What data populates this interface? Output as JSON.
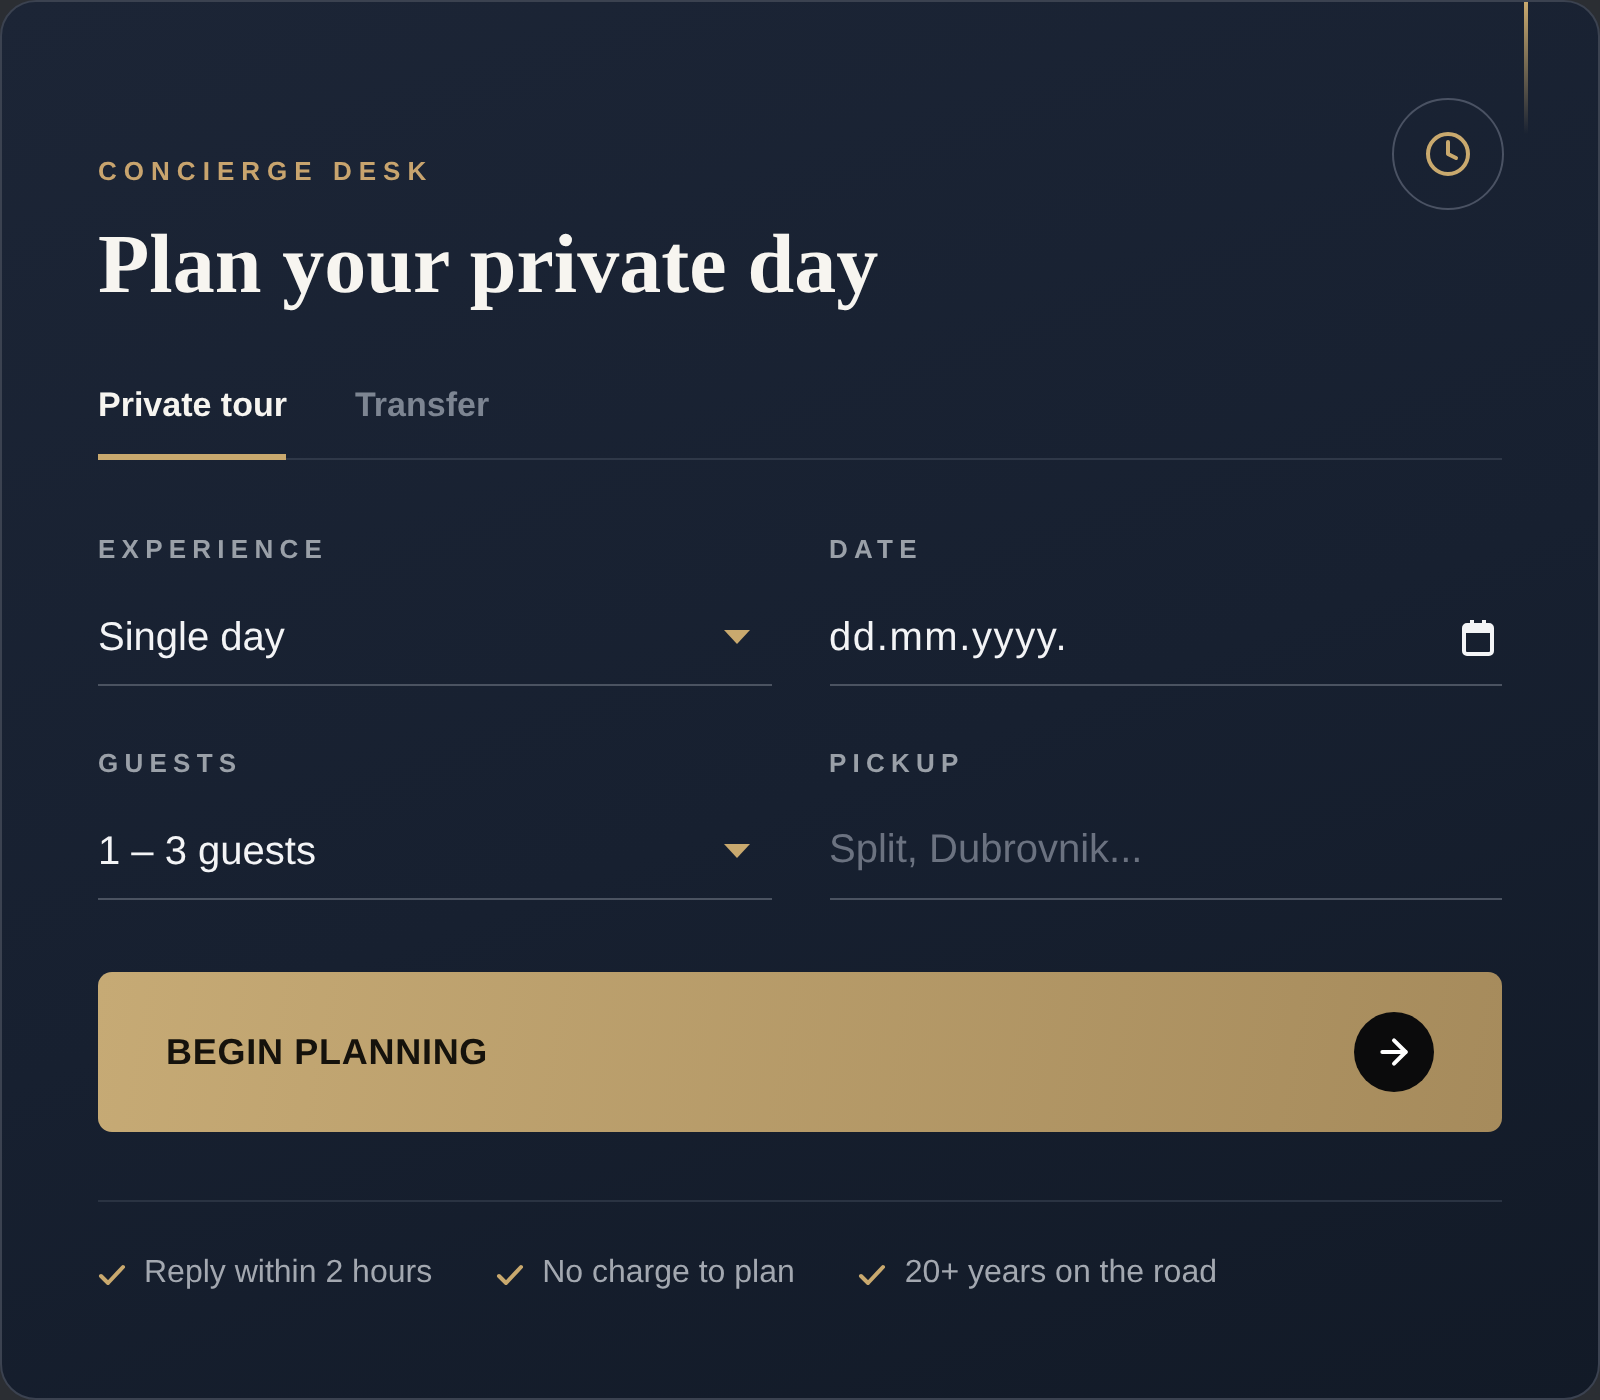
{
  "header": {
    "eyebrow": "CONCIERGE DESK",
    "title": "Plan your private day"
  },
  "tabs": [
    {
      "label": "Private tour",
      "selected": true
    },
    {
      "label": "Transfer",
      "selected": false
    }
  ],
  "fields": [
    {
      "kind": "select",
      "label": "EXPERIENCE",
      "value": "Single day"
    },
    {
      "kind": "date",
      "label": "DATE",
      "value": "dd.mm.yyyy."
    },
    {
      "kind": "select",
      "label": "GUESTS",
      "value": "1 – 3 guests"
    },
    {
      "kind": "text",
      "label": "PICKUP",
      "placeholder": "Split, Dubrovnik..."
    }
  ],
  "submit_button": {
    "label": "BEGIN PLANNING"
  },
  "assurances": [
    {
      "text": "Reply within 2 hours"
    },
    {
      "text": "No charge to plan"
    },
    {
      "text": "20+ years on the road"
    }
  ]
}
